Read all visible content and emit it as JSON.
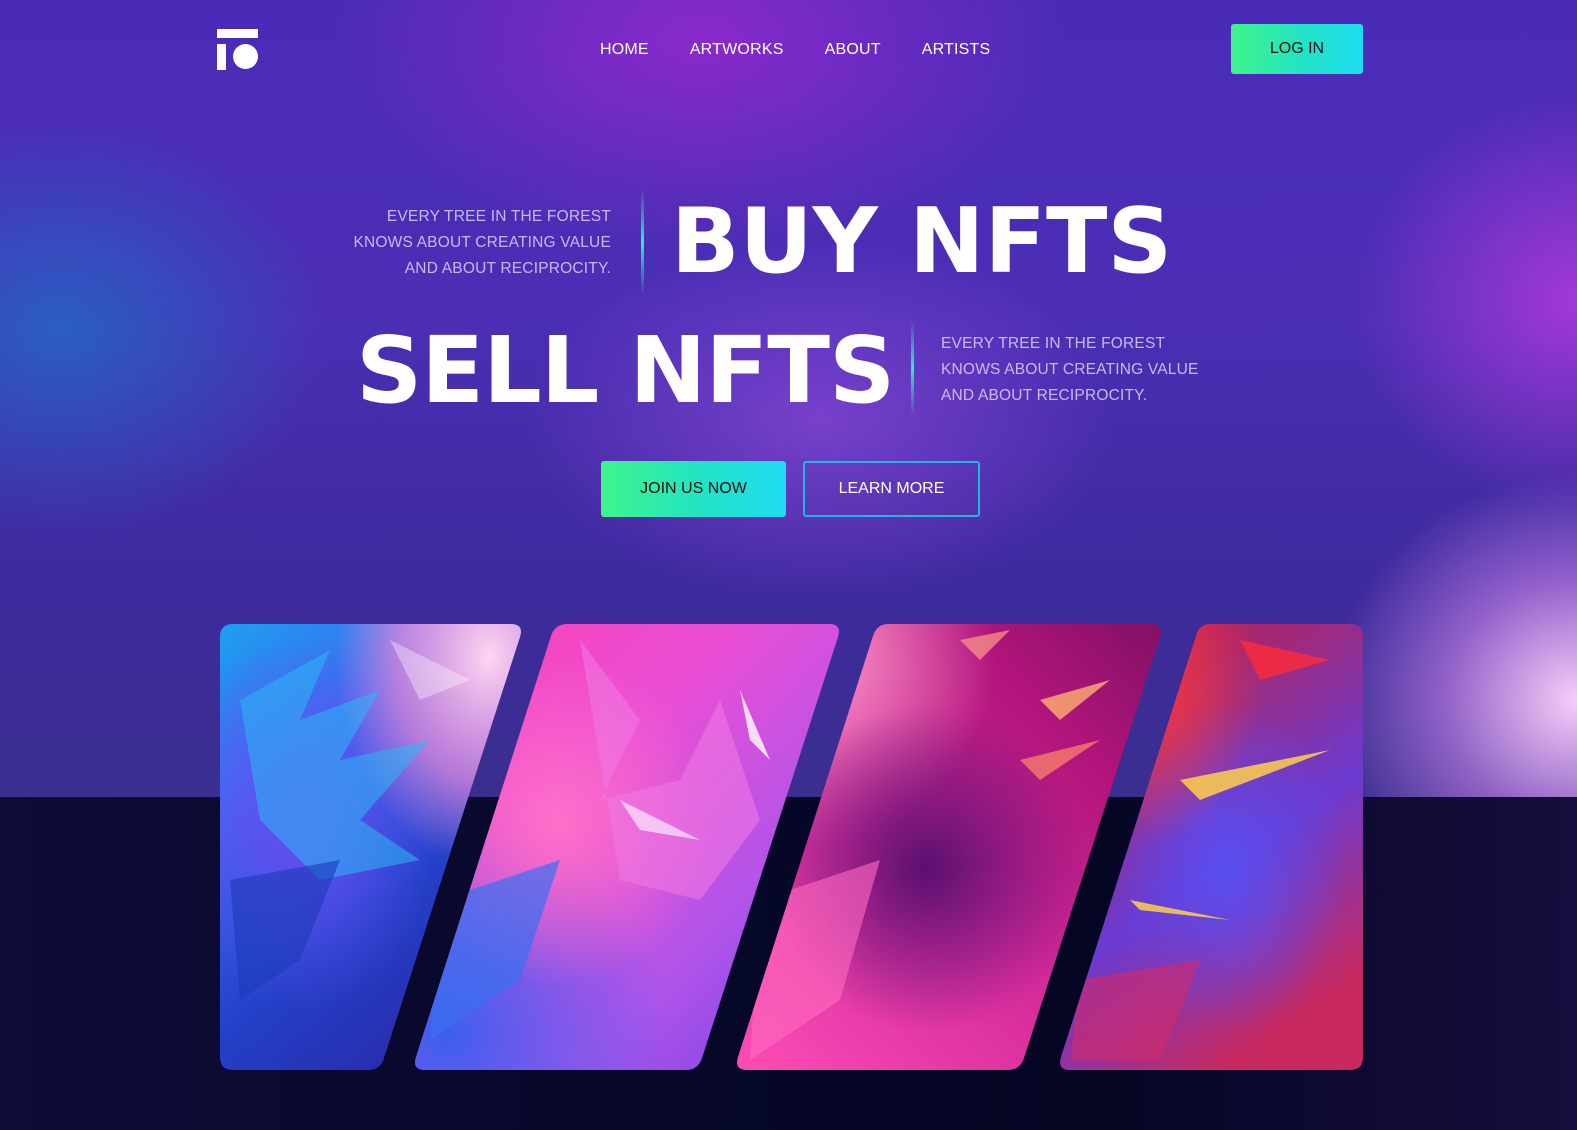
{
  "nav": {
    "logo_icon": "brand-logo-icon",
    "links": [
      "HOME",
      "ARTWORKS",
      "ABOUT",
      "ARTISTS"
    ],
    "login_label": "LOG IN"
  },
  "hero": {
    "tagline_top": [
      "EVERY TREE IN THE FOREST",
      "KNOWS ABOUT CREATING VALUE",
      "AND ABOUT RECIPROCITY."
    ],
    "headline_buy": "BUY NFTS",
    "headline_sell": "SELL NFTS",
    "tagline_bottom": [
      "EVERY TREE IN THE FOREST",
      "KNOWS ABOUT CREATING VALUE",
      "AND ABOUT RECIPROCITY."
    ],
    "join_label": "JOIN US NOW",
    "learn_label": "LEARN MORE"
  },
  "colors": {
    "accent_green": "#3ef58a",
    "accent_cyan": "#1fdcf2",
    "hero_purple": "#4a2bb8",
    "dark_navy": "#070728"
  },
  "gallery": {
    "artworks": [
      "artwork-1",
      "artwork-2",
      "artwork-3",
      "artwork-4"
    ]
  }
}
